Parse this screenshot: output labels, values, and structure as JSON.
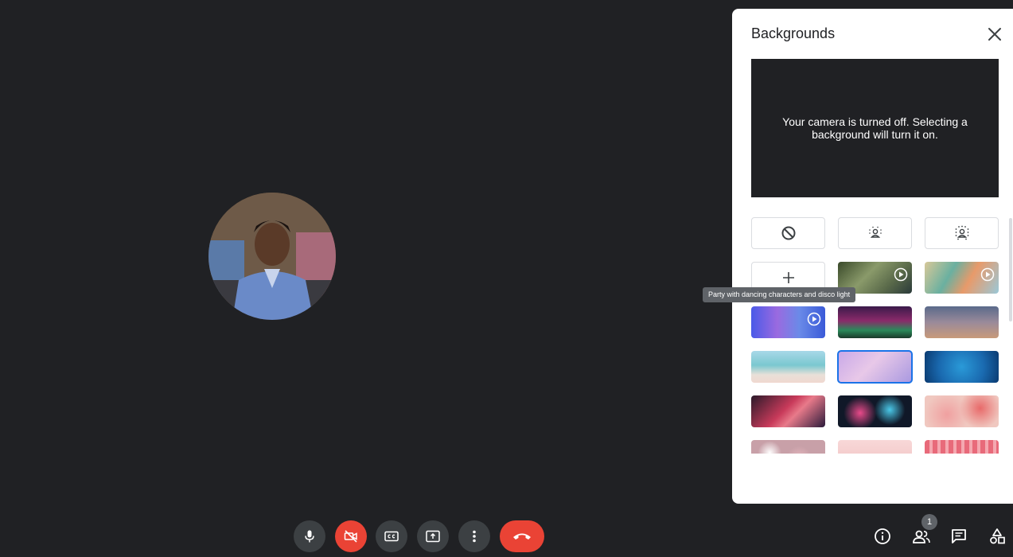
{
  "panel": {
    "title": "Backgrounds",
    "preview_message": "Your camera is turned off. Selecting a background will turn it on."
  },
  "tooltip": {
    "text": "Party with dancing characters and disco light"
  },
  "backgrounds": {
    "options": [
      {
        "id": "no-effect",
        "icon": "block-icon"
      },
      {
        "id": "slight-blur",
        "icon": "blur-person-icon"
      },
      {
        "id": "blur",
        "icon": "blur-person-strong-icon"
      },
      {
        "id": "upload",
        "icon": "plus-icon"
      }
    ]
  },
  "participants": {
    "count": "1"
  },
  "colors": {
    "hangup": "#ea4335",
    "camera_off": "#ea4335",
    "control_bg": "#3c4043",
    "selected_outline": "#1a73e8",
    "stage_bg": "#202124"
  }
}
